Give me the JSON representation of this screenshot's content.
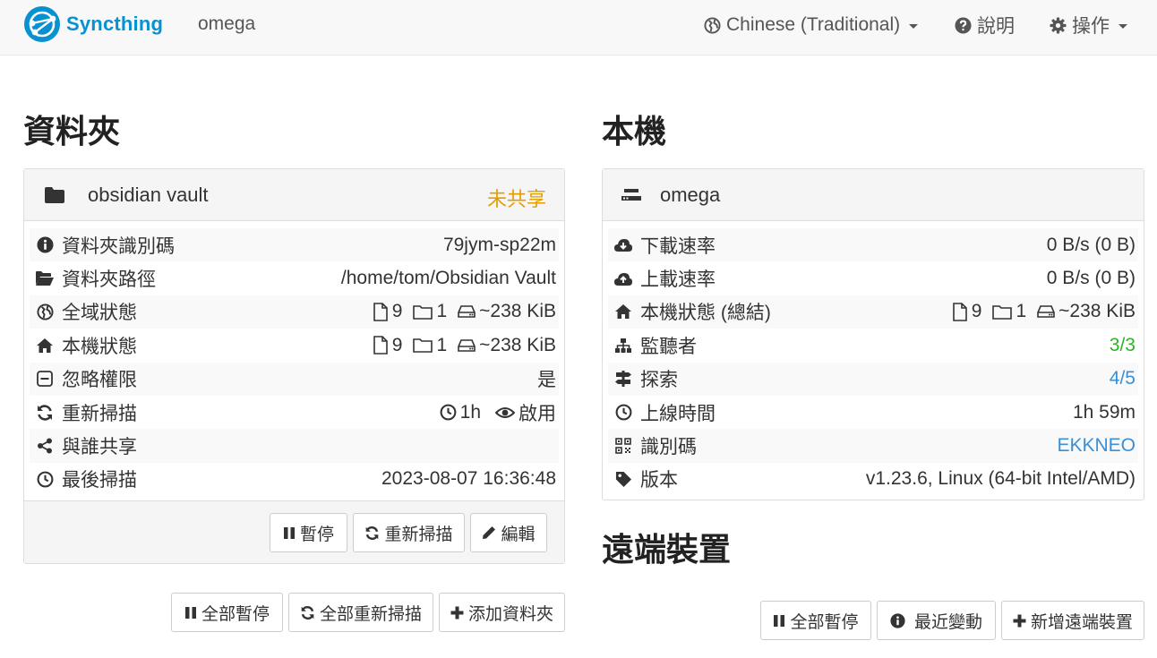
{
  "navbar": {
    "brand": "Syncthing",
    "device_name": "omega",
    "language": "Chinese (Traditional)",
    "help": "說明",
    "actions": "操作"
  },
  "folders": {
    "heading": "資料夾",
    "folder": {
      "name": "obsidian vault",
      "status": "未共享",
      "rows": {
        "folder_id": {
          "label": "資料夾識別碼",
          "value": "79jym-sp22m"
        },
        "folder_path": {
          "label": "資料夾路徑",
          "value": "/home/tom/Obsidian Vault"
        },
        "global_state": {
          "label": "全域狀態",
          "files": "9",
          "dirs": "1",
          "size": "~238 KiB"
        },
        "local_state": {
          "label": "本機狀態",
          "files": "9",
          "dirs": "1",
          "size": "~238 KiB"
        },
        "ignore_perms": {
          "label": "忽略權限",
          "value": "是"
        },
        "rescan": {
          "label": "重新掃描",
          "interval": "1h",
          "watch": "啟用"
        },
        "shared_with": {
          "label": "與誰共享",
          "value": ""
        },
        "last_scan": {
          "label": "最後掃描",
          "value": "2023-08-07 16:36:48"
        }
      },
      "buttons": {
        "pause": "暫停",
        "rescan": "重新掃描",
        "edit": "編輯"
      }
    },
    "buttons": {
      "pause_all": "全部暫停",
      "rescan_all": "全部重新掃描",
      "add_folder": "添加資料夾"
    }
  },
  "this_device": {
    "heading": "本機",
    "name": "omega",
    "rows": {
      "download_rate": {
        "label": "下載速率",
        "value": "0 B/s (0 B)"
      },
      "upload_rate": {
        "label": "上載速率",
        "value": "0 B/s (0 B)"
      },
      "local_state_total": {
        "label": "本機狀態 (總結)",
        "files": "9",
        "dirs": "1",
        "size": "~238 KiB"
      },
      "listeners": {
        "label": "監聽者",
        "value": "3/3"
      },
      "discovery": {
        "label": "探索",
        "value": "4/5"
      },
      "uptime": {
        "label": "上線時間",
        "value": "1h 59m"
      },
      "identification": {
        "label": "識別碼",
        "value": "EKKNEO"
      },
      "version": {
        "label": "版本",
        "value": "v1.23.6, Linux (64-bit Intel/AMD)"
      }
    }
  },
  "remote_devices": {
    "heading": "遠端裝置",
    "buttons": {
      "pause_all": "全部暫停",
      "recent_changes": "最近變動",
      "add_device": "新增遠端裝置"
    }
  },
  "colors": {
    "brand": "#0891d1",
    "unshared": "#e29e05",
    "green": "#2cb52a",
    "blue": "#3a8fd6"
  }
}
